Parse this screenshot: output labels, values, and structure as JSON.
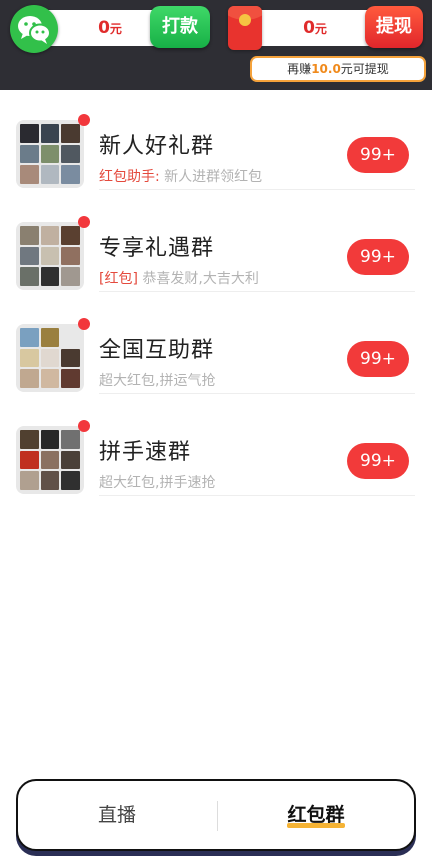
{
  "header": {
    "wechat_icon": "wechat-icon",
    "left_amount": "0",
    "left_unit": "元",
    "pay_button": "打款",
    "redpack_icon": "red-packet-icon",
    "right_amount": "0",
    "right_unit": "元",
    "withdraw_button": "提现",
    "tip_prefix": "再赚",
    "tip_amount": "10.0",
    "tip_suffix": "元可提现"
  },
  "groups": [
    {
      "title": "新人好礼群",
      "tag": "红包助手:",
      "subtitle": " 新人进群领红包",
      "badge": "99+",
      "unread_dot": true,
      "avatar_colors": [
        "#2a2a30",
        "#3a4450",
        "#4a3a30",
        "#6b7c8a",
        "#7d8f6b",
        "#505860",
        "#a88a7a",
        "#b0b8c0",
        "#7a8ca0"
      ]
    },
    {
      "title": "专享礼遇群",
      "tag": "[红包]",
      "subtitle": " 恭喜发财,大吉大利",
      "badge": "99+",
      "unread_dot": true,
      "avatar_colors": [
        "#8a8070",
        "#c0b0a0",
        "#5a4030",
        "#707880",
        "#c8c0b0",
        "#907060",
        "#6a7068",
        "#303030",
        "#a09890"
      ]
    },
    {
      "title": "全国互助群",
      "tag": "",
      "subtitle": "超大红包,拼运气抢",
      "badge": "99+",
      "unread_dot": true,
      "avatar_colors": [
        "#7aa0c0",
        "#9a8040",
        "#e8e8e8",
        "#d8c8a0",
        "#e0d8d0",
        "#4a3a30",
        "#c0a890",
        "#d0b8a0",
        "#603a30"
      ]
    },
    {
      "title": "拼手速群",
      "tag": "",
      "subtitle": "超大红包,拼手速抢",
      "badge": "99+",
      "unread_dot": true,
      "avatar_colors": [
        "#504030",
        "#282828",
        "#707070",
        "#c03020",
        "#8a7060",
        "#4a4038",
        "#b0a090",
        "#605048",
        "#303030"
      ]
    }
  ],
  "tabs": {
    "live": "直播",
    "group": "红包群"
  }
}
